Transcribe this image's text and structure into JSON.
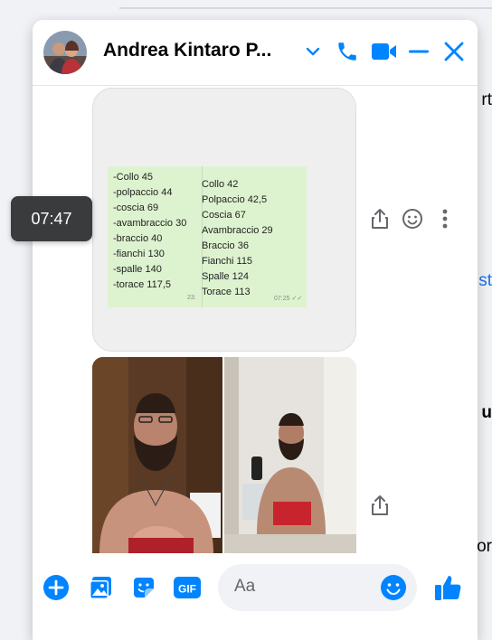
{
  "chat": {
    "contact_name": "Andrea Kintaro P...",
    "composer_placeholder": "Aa"
  },
  "messages": {
    "hover_timestamp": "07:47",
    "measurements_before": [
      "-Collo 45",
      "-polpaccio 44",
      "-coscia 69",
      "-avambraccio 30",
      "-braccio 40",
      "-fianchi 130",
      "-spalle 140",
      "-torace 117,5"
    ],
    "measurements_after": [
      "Collo 42",
      "Polpaccio 42,5",
      "Coscia 67",
      "Avambraccio 29",
      "Braccio 36",
      "Fianchi 115",
      "Spalle 124",
      "Torace 113"
    ],
    "note_time_left": "23:",
    "note_time_right": "07:25 ✓✓"
  },
  "background_fragments": [
    "rt",
    "st",
    "u",
    "or"
  ],
  "colors": {
    "accent": "#0084ff"
  }
}
